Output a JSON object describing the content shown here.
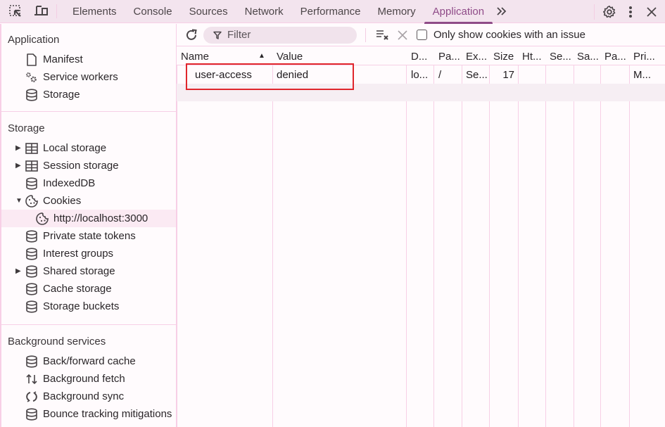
{
  "toolbar": {
    "inspect_icon": "inspect-element-icon",
    "device_icon": "device-toolbar-icon",
    "tabs": [
      {
        "label": "Elements",
        "active": false
      },
      {
        "label": "Console",
        "active": false
      },
      {
        "label": "Sources",
        "active": false
      },
      {
        "label": "Network",
        "active": false
      },
      {
        "label": "Performance",
        "active": false
      },
      {
        "label": "Memory",
        "active": false
      },
      {
        "label": "Application",
        "active": true
      }
    ],
    "more_tabs_glyph": "»",
    "settings_icon": "gear-icon",
    "menu_icon": "kebab-menu-icon",
    "close_icon": "close-icon",
    "accent_color": "#8f4b88"
  },
  "sidebar": {
    "sections": [
      {
        "title": "Application",
        "items": [
          {
            "label": "Manifest",
            "icon": "document-icon"
          },
          {
            "label": "Service workers",
            "icon": "gears-icon"
          },
          {
            "label": "Storage",
            "icon": "database-icon"
          }
        ]
      },
      {
        "title": "Storage",
        "items": [
          {
            "label": "Local storage",
            "icon": "table-icon",
            "expander": "collapsed"
          },
          {
            "label": "Session storage",
            "icon": "table-icon",
            "expander": "collapsed"
          },
          {
            "label": "IndexedDB",
            "icon": "database-icon"
          },
          {
            "label": "Cookies",
            "icon": "cookie-icon",
            "expander": "expanded"
          },
          {
            "label": "http://localhost:3000",
            "icon": "cookie-icon",
            "child": true,
            "selected": true
          },
          {
            "label": "Private state tokens",
            "icon": "database-icon"
          },
          {
            "label": "Interest groups",
            "icon": "database-icon"
          },
          {
            "label": "Shared storage",
            "icon": "database-icon",
            "expander": "collapsed"
          },
          {
            "label": "Cache storage",
            "icon": "database-icon"
          },
          {
            "label": "Storage buckets",
            "icon": "database-icon"
          }
        ]
      },
      {
        "title": "Background services",
        "items": [
          {
            "label": "Back/forward cache",
            "icon": "database-icon"
          },
          {
            "label": "Background fetch",
            "icon": "up-down-arrows-icon"
          },
          {
            "label": "Background sync",
            "icon": "sync-icon"
          },
          {
            "label": "Bounce tracking mitigations",
            "icon": "database-icon"
          }
        ]
      }
    ]
  },
  "filterbar": {
    "refresh_icon": "refresh-icon",
    "filter_placeholder": "Filter",
    "clear_all_icon": "clear-all-icon",
    "delete_selected_icon": "delete-icon",
    "only_issues_label": "Only show cookies with an issue",
    "only_issues_checked": false
  },
  "cookies_table": {
    "columns": [
      "Name",
      "Value",
      "D...",
      "Pa...",
      "Ex...",
      "Size",
      "Ht...",
      "Se...",
      "Sa...",
      "Pa...",
      "Pri..."
    ],
    "sort_column": "Name",
    "sort_direction": "ascending",
    "rows": [
      [
        "user-access",
        "denied",
        "lo...",
        "/",
        "Se...",
        "17",
        "",
        "",
        "",
        "",
        "M..."
      ]
    ],
    "highlighted_row": 0,
    "highlight_color": "#e0262c"
  }
}
